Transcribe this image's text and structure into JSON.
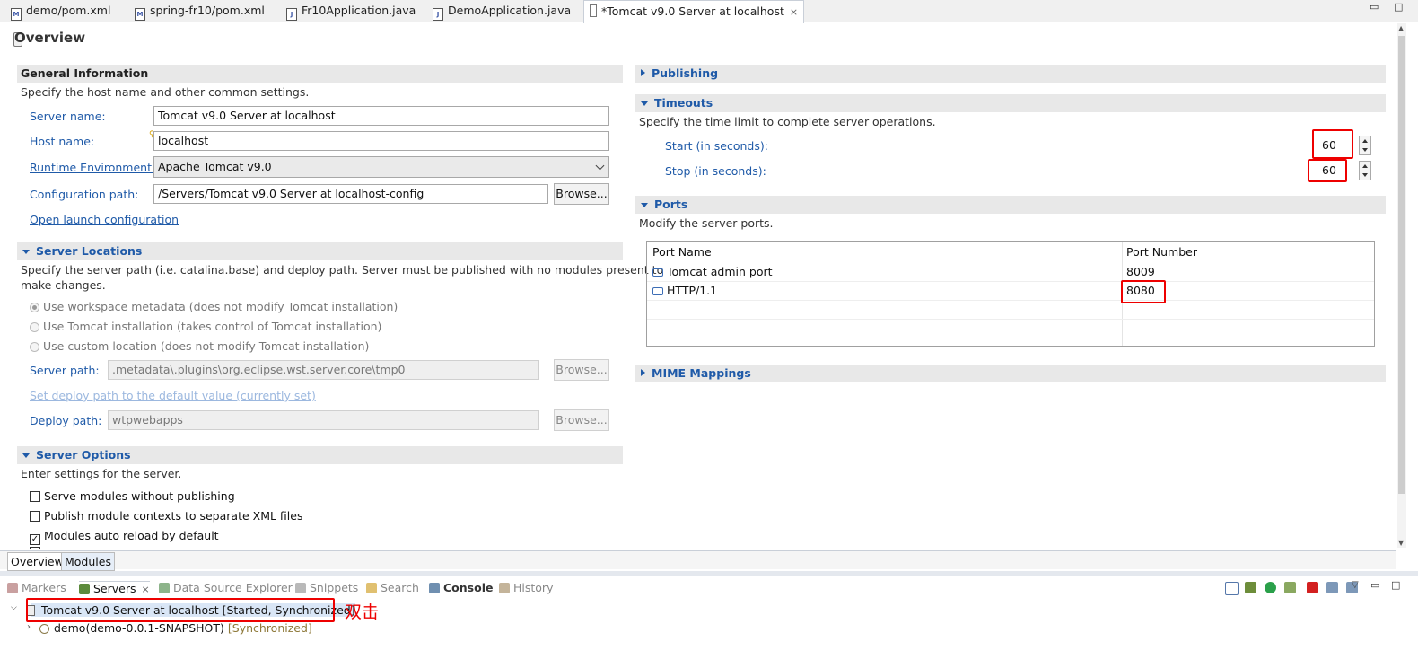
{
  "editor_tabs": [
    {
      "label": "demo/pom.xml",
      "icon": "maven-pom-icon"
    },
    {
      "label": "spring-fr10/pom.xml",
      "icon": "maven-pom-icon"
    },
    {
      "label": "Fr10Application.java",
      "icon": "java-file-icon"
    },
    {
      "label": "DemoApplication.java",
      "icon": "java-file-icon"
    },
    {
      "label": "*Tomcat v9.0 Server at localhost",
      "icon": "server-icon",
      "active": true
    }
  ],
  "overview": {
    "title": "Overview",
    "general": {
      "header": "General Information",
      "desc": "Specify the host name and other common settings.",
      "server_name_label": "Server name:",
      "server_name_value": "Tomcat v9.0 Server at localhost",
      "host_name_label": "Host name:",
      "host_name_value": "localhost",
      "runtime_label": "Runtime Environment:",
      "runtime_value": "Apache Tomcat v9.0",
      "config_label": "Configuration path:",
      "config_value": "/Servers/Tomcat v9.0 Server at localhost-config",
      "browse": "Browse...",
      "open_launch": "Open launch configuration"
    },
    "locations": {
      "header": "Server Locations",
      "desc_line1": "Specify the server path (i.e. catalina.base) and deploy path. Server must be published with no modules present to",
      "desc_line2": "make changes.",
      "radio1": "Use workspace metadata (does not modify Tomcat installation)",
      "radio2": "Use Tomcat installation (takes control of Tomcat installation)",
      "radio3": "Use custom location (does not modify Tomcat installation)",
      "server_path_label": "Server path:",
      "server_path_value": ".metadata\\.plugins\\org.eclipse.wst.server.core\\tmp0",
      "set_deploy": "Set deploy path to the default value (currently set)",
      "deploy_label": "Deploy path:",
      "deploy_value": "wtpwebapps",
      "browse": "Browse..."
    },
    "options": {
      "header": "Server Options",
      "desc": "Enter settings for the server.",
      "items": [
        {
          "label": "Serve modules without publishing",
          "checked": false
        },
        {
          "label": "Publish module contexts to separate XML files",
          "checked": false
        },
        {
          "label": "Modules auto reload by default",
          "checked": true
        }
      ]
    },
    "publishing": {
      "header": "Publishing"
    },
    "timeouts": {
      "header": "Timeouts",
      "desc": "Specify the time limit to complete server operations.",
      "start_label": "Start (in seconds):",
      "start_value": "60",
      "stop_label": "Stop (in seconds):",
      "stop_value": "60"
    },
    "ports": {
      "header": "Ports",
      "desc": "Modify the server ports.",
      "col_name": "Port Name",
      "col_number": "Port Number",
      "rows": [
        {
          "name": "Tomcat admin port",
          "number": "8009"
        },
        {
          "name": "HTTP/1.1",
          "number": "8080"
        }
      ]
    },
    "mime": {
      "header": "MIME Mappings"
    }
  },
  "page_tabs": [
    "Overview",
    "Modules"
  ],
  "views": {
    "tabs": [
      {
        "label": "Markers",
        "icon": "markers-icon"
      },
      {
        "label": "Servers",
        "icon": "servers-icon",
        "active": true
      },
      {
        "label": "Data Source Explorer",
        "icon": "data-source-icon"
      },
      {
        "label": "Snippets",
        "icon": "snippets-icon"
      },
      {
        "label": "Search",
        "icon": "search-icon"
      },
      {
        "label": "Console",
        "icon": "console-icon"
      },
      {
        "label": "History",
        "icon": "history-icon"
      }
    ],
    "server_entry": "Tomcat v9.0 Server at localhost  [Started, Synchronized]",
    "annotation": "双击",
    "module_name": "demo(demo-0.0.1-SNAPSHOT)",
    "module_status": "[Synchronized]"
  },
  "colors": {
    "accent": "#1f5aa8",
    "highlight": "#e00000"
  }
}
